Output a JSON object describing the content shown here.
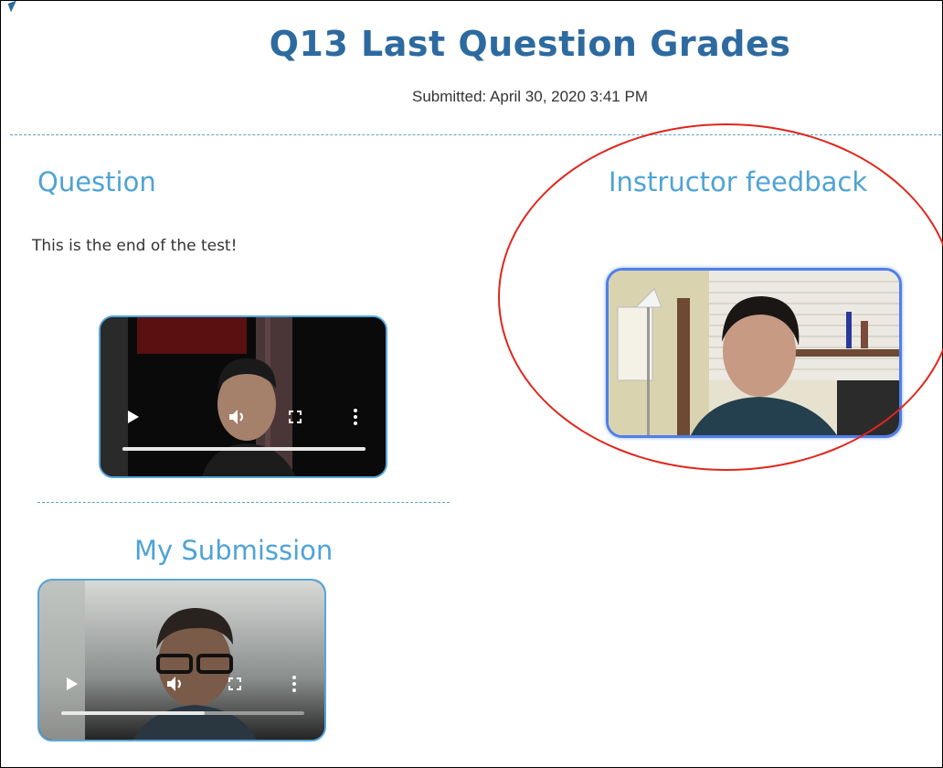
{
  "page": {
    "title": "Q13 Last Question Grades",
    "submitted": "Submitted: April 30, 2020 3:41 PM"
  },
  "question": {
    "heading": "Question",
    "text": "This is the end of the test!",
    "video": {
      "progress": 1.0
    }
  },
  "feedback": {
    "heading": "Instructor feedback",
    "annotation_color": "#e0261d"
  },
  "submission": {
    "heading": "My Submission",
    "video": {
      "progress": 0.59
    }
  },
  "icons": [
    "play-icon",
    "volume-icon",
    "fullscreen-icon",
    "more-vert-icon"
  ],
  "colors": {
    "title": "#2d6aa0",
    "heading": "#4ea3d6",
    "video_border": "#57a6db"
  }
}
